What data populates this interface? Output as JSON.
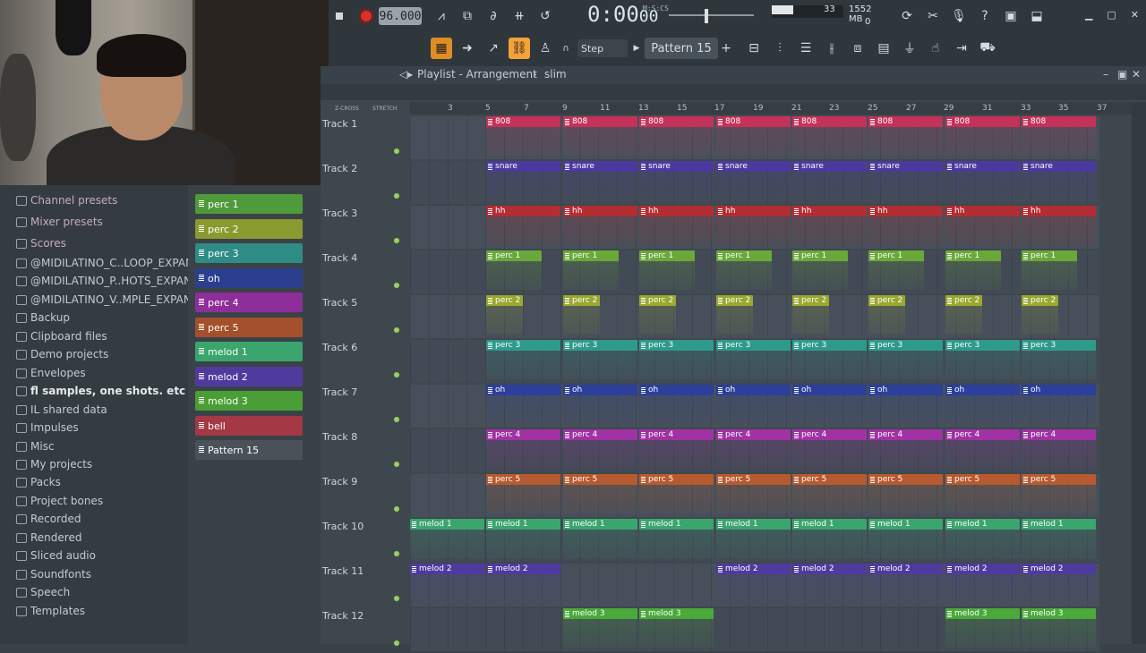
{
  "toolbar": {
    "tempo": "96.000",
    "time": "0:00",
    "time_sub": "00",
    "time_label": "M:S:CS",
    "cpu_value": "33",
    "memory": "1552 MB",
    "voices": "0",
    "snap": "Step",
    "pattern": "Pattern 15"
  },
  "playlist": {
    "title": "Playlist - Arrangement",
    "separator": "›",
    "pattern": "slim",
    "ruler_left": "Z-CROSS",
    "ruler_right": "STRETCH",
    "ruler": [
      "3",
      "5",
      "7",
      "9",
      "11",
      "13",
      "15",
      "17",
      "19",
      "21",
      "23",
      "25",
      "27",
      "29",
      "31",
      "33",
      "35",
      "37"
    ],
    "tracks": [
      "Track 1",
      "Track 2",
      "Track 3",
      "Track 4",
      "Track 5",
      "Track 6",
      "Track 7",
      "Track 8",
      "Track 9",
      "Track 10",
      "Track 11",
      "Track 12"
    ]
  },
  "browser": {
    "items": [
      "Channel presets",
      "Mixer presets",
      "Scores",
      "@MIDILATINO_C..LOOP_EXPANSION",
      "@MIDILATINO_P..HOTS_EXPANSION",
      "@MIDILATINO_V..MPLE_EXPANSION",
      "Backup",
      "Clipboard files",
      "Demo projects",
      "Envelopes",
      "fl samples, one shots. etc",
      "IL shared data",
      "Impulses",
      "Misc",
      "My projects",
      "Packs",
      "Project bones",
      "Recorded",
      "Rendered",
      "Sliced audio",
      "Soundfonts",
      "Speech",
      "Templates"
    ]
  },
  "patterns": [
    {
      "label": "perc 1",
      "color": "#4f9a3a"
    },
    {
      "label": "perc 2",
      "color": "#8a9a2e"
    },
    {
      "label": "perc 3",
      "color": "#2e8c86"
    },
    {
      "label": "oh",
      "color": "#2c3f8e"
    },
    {
      "label": "perc 4",
      "color": "#8e2e9a"
    },
    {
      "label": "perc 5",
      "color": "#a4502c"
    },
    {
      "label": "melod 1",
      "color": "#3aa56d"
    },
    {
      "label": "melod 2",
      "color": "#4f3a9e"
    },
    {
      "label": "melod 3",
      "color": "#4a9e36"
    },
    {
      "label": "bell",
      "color": "#a43844"
    },
    {
      "label": "Pattern 15",
      "color": "#4a5259"
    }
  ],
  "clips": {
    "808": "808",
    "snare": "snare",
    "hh": "hh",
    "perc1": "perc 1",
    "perc2": "perc 2",
    "perc3": "perc 3",
    "oh": "oh",
    "perc4": "perc 4",
    "perc5": "perc 5",
    "melod1": "melod 1",
    "melod2": "melod 2",
    "melod3": "melod 3"
  },
  "colors": {
    "808": "#c4325a",
    "snare": "#4b3a9e",
    "hh": "#b32d34",
    "perc1": "#6aa83a",
    "perc2": "#9aa82e",
    "perc3": "#2e9a8c",
    "oh": "#2c3f9a",
    "perc4": "#a032a6",
    "perc5": "#b85a30",
    "melod1": "#3aa56d",
    "melod2": "#4f3a9e",
    "melod3": "#4aa93a"
  }
}
